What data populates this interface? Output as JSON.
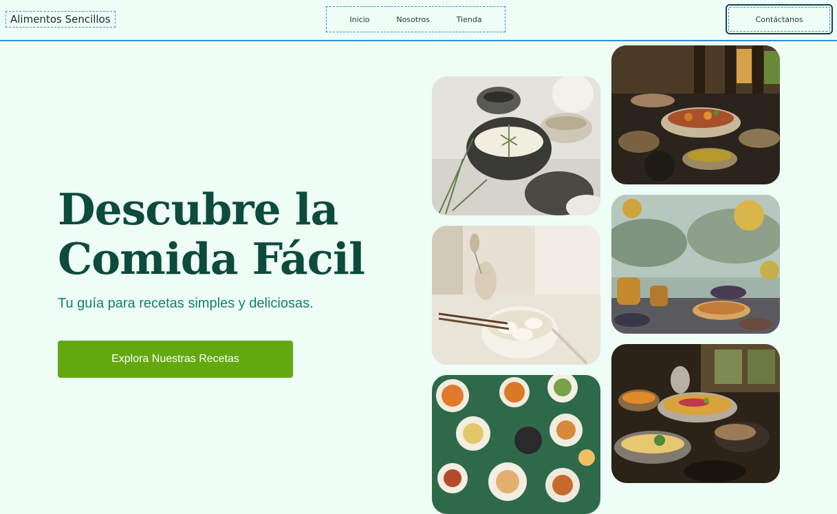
{
  "header": {
    "logo": "Alimentos Sencillos",
    "nav": [
      "Inicio",
      "Nosotros",
      "Tienda"
    ],
    "contact_label": "Contáctanos"
  },
  "hero": {
    "title_line1": "Descubre la",
    "title_line2": "Comida Fácil",
    "subtitle": "Tu guía para recetas simples y deliciosas.",
    "cta_label": "Explora Nuestras Recetas"
  },
  "gallery": [
    {
      "name": "rustic-soup-bowls-photo"
    },
    {
      "name": "dumplings-bowl-photo"
    },
    {
      "name": "green-table-spread-photo"
    },
    {
      "name": "curry-dishes-photo"
    },
    {
      "name": "outdoor-picnic-photo"
    },
    {
      "name": "rice-feast-photo"
    }
  ],
  "colors": {
    "background": "#eefdf6",
    "title": "#0d4b3c",
    "subtitle": "#13806a",
    "cta": "#64a80f",
    "header_border": "#2b8fd8"
  }
}
